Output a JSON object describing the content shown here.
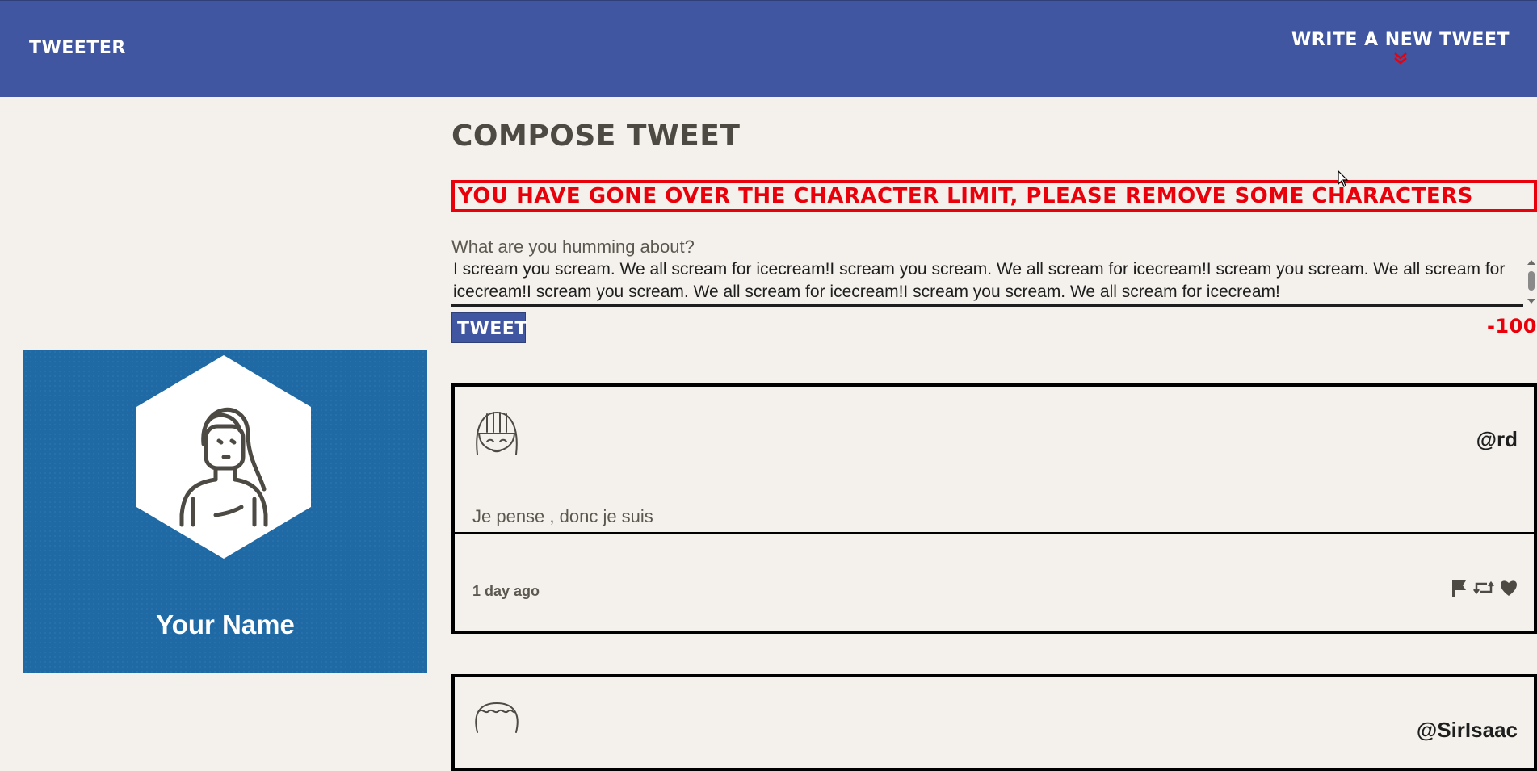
{
  "nav": {
    "brand": "Tweeter",
    "write_label": "Write a new tweet"
  },
  "profile": {
    "name": "Your Name"
  },
  "compose": {
    "title": "Compose Tweet",
    "error": "You have gone over the character limit, please remove some characters",
    "label": "What are you humming about?",
    "text": "I scream you scream. We all scream for icecream!I scream you scream. We all scream for icecream!I scream you scream. We all scream for icecream!I scream you scream. We all scream for icecream!I scream you scream. We all scream for icecream!",
    "submit_label": "Tweet",
    "counter": "-100"
  },
  "tweets": [
    {
      "handle": "@rd",
      "body": "Je pense , donc je suis",
      "time": "1 day ago",
      "actions": [
        "flag-icon",
        "retweet-icon",
        "heart-icon"
      ]
    },
    {
      "handle": "@SirIsaac"
    }
  ],
  "colors": {
    "nav": "#4056a1",
    "background": "#f4f1ec",
    "profile": "#1f6aa5",
    "error": "#e8000b"
  }
}
